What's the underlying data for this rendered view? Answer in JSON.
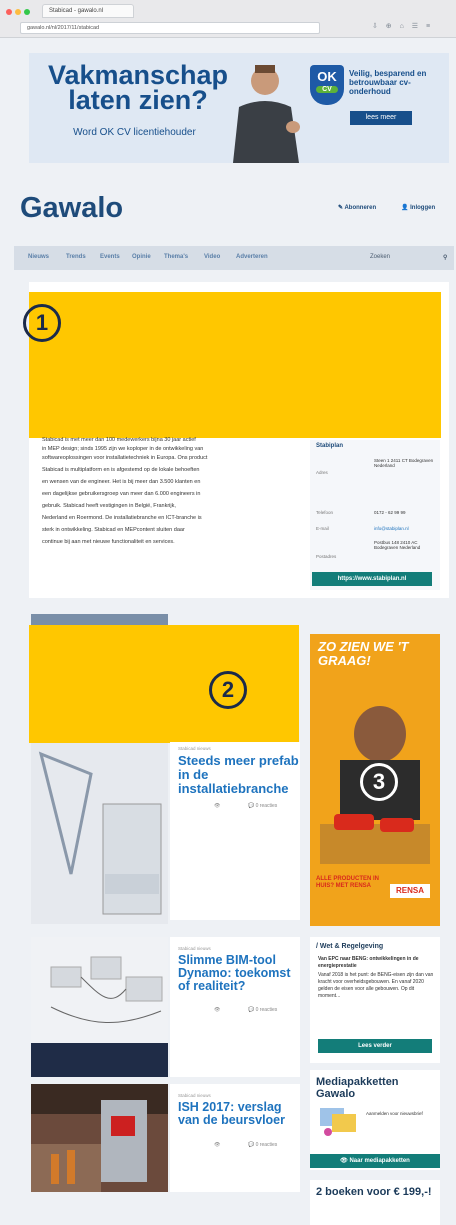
{
  "browser": {
    "tab_title": "Stabicad - gawalo.nl",
    "url": "gawalo.nl/nl/2017/11/stabicad",
    "toolbar_icons": "⇩ ⊕ ⌂ ☰ ≡"
  },
  "ad": {
    "title": "Vakmanschap laten zien?",
    "subtitle": "Word OK CV licentiehouder",
    "badge_main": "OK",
    "badge_sub": "CV",
    "right_text": "Veilig, besparend en betrouwbaar cv-onderhoud",
    "button": "lees meer"
  },
  "header": {
    "logo": "Gawalo",
    "subscribe": "✎ Abonneren",
    "login": "👤 Inloggen"
  },
  "nav": {
    "items": [
      "Nieuws",
      "Trends",
      "Events",
      "Opinie",
      "Thema's",
      "Video",
      "Adverteren"
    ],
    "search_placeholder": "Zoeken"
  },
  "redactions": {
    "one": "1",
    "two": "2",
    "three": "3"
  },
  "article": {
    "body": [
      "Stabicad is met meer dan 100 medewerkers bijna 30 jaar actief",
      "in MEP design; sinds 1995 zijn we koploper in de ontwikkeling van",
      "softwareoplossingen voor installatietechniek in Europa. Ons product",
      "Stabicad is multiplatform en is afgestemd op de lokale behoeften",
      "en wensen van de engineer. Het is bij meer dan 3.500 klanten en",
      "een dagelijkse gebruikersgroep van meer dan 6.000 engineers in",
      "gebruik. Stabicad heeft vestigingen in België, Frankrijk,",
      "Nederland en Roermond. De installatiebranche en ICT-branche is",
      "sterk in ontwikkeling. Stabicad en MEPcontent sluiten daar",
      "continue bij aan met nieuwe functionaliteit en services."
    ],
    "sidebar": {
      "title": "Stabiplan",
      "rows": [
        {
          "label": "Adres",
          "value": "Steen 1 2411 CT Bodegraven Nederland"
        },
        {
          "label": "Telefoon",
          "value": "0172 - 62 99 99"
        },
        {
          "label": "E-mail",
          "value": "info@stabiplan.nl"
        },
        {
          "label": "Postadres",
          "value": "Postbus 148 2410 AC Bodegraven Nederland"
        }
      ],
      "button": "https://www.stabiplan.nl"
    }
  },
  "feed": [
    {
      "category": "Stabicad nieuws",
      "title": "Steeds meer prefab in de installatiebranche",
      "views": "👁",
      "comments": "💬 0 reacties"
    },
    {
      "category": "Stabicad nieuws",
      "title": "Slimme BIM-tool Dynamo: toekomst of realiteit?",
      "views": "👁",
      "comments": "💬 0 reacties"
    },
    {
      "category": "Stabicad nieuws",
      "title": "ISH 2017: verslag van de beursvloer",
      "views": "👁",
      "comments": "💬 0 reacties"
    }
  ],
  "side_ad": {
    "headline": "ZO ZIEN WE 'T GRAAG!",
    "bottom": "ALLE PRODUCTEN IN HUIS? MET RENSA",
    "brand": "RENSA"
  },
  "widgets": {
    "law": {
      "title": "/ Wet & Regelgeving",
      "headline": "Van EPC naar BENG: ontwikkelingen in de energieprestatie",
      "text": "Vanaf 2018 is het punt: de BENG-eisen zijn dan van kracht voor overheidsgebouwen. En vanaf 2020 gelden de eisen voor alle gebouwen. Op dit moment...",
      "button": "Lees verder"
    },
    "media": {
      "title": "Mediapakketten Gawalo",
      "text": "Aanmelden voor nieuwsbrief",
      "button": "👁 Naar mediapakketten"
    },
    "books": {
      "title": "2 boeken voor € 199,-!"
    }
  },
  "colors": {
    "mask": "#ffc700",
    "teal": "#137d79",
    "brand_blue": "#1e4b7a",
    "link_blue": "#1e73be"
  }
}
